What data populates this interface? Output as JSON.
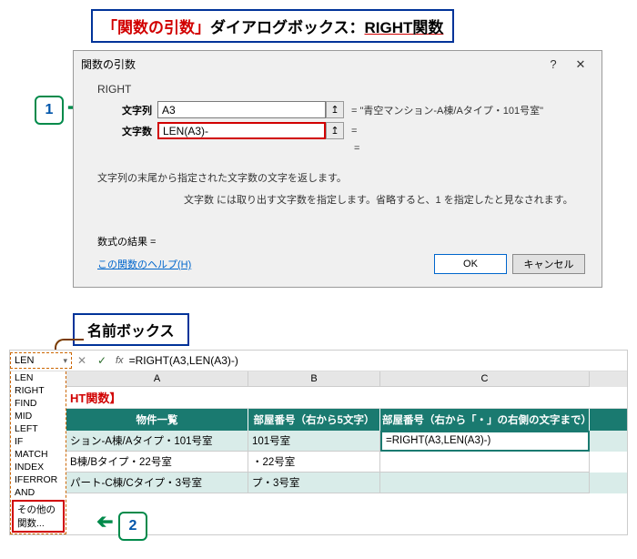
{
  "callout1": {
    "part1": "「関数の引数」",
    "part2": "ダイアログボックス：",
    "part3": "RIGHT関数"
  },
  "dialog": {
    "title": "関数の引数",
    "help_icon": "?",
    "close_icon": "✕",
    "func_name": "RIGHT",
    "arg1_label": "文字列",
    "arg1_value": "A3",
    "arg1_result": "=  \"青空マンション-A棟/Aタイプ・101号室\"",
    "arg2_label": "文字数",
    "arg2_value": "LEN(A3)-",
    "arg2_result": "=",
    "eq_only": "=",
    "desc_main": "文字列の末尾から指定された文字数の文字を返します。",
    "desc_sub": "文字数   には取り出す文字数を指定します。省略すると、1 を指定したと見なされます。",
    "formula_result": "数式の結果 =",
    "help_link": "この関数のヘルプ(H)",
    "ok": "OK",
    "cancel": "キャンセル"
  },
  "step1": "1",
  "callout2": "名前ボックス",
  "namebox_value": "LEN",
  "formula_bar": {
    "cross": "✕",
    "check": "✓",
    "fx": "fx",
    "value": "=RIGHT(A3,LEN(A3)-)"
  },
  "func_list": [
    "LEN",
    "RIGHT",
    "FIND",
    "MID",
    "LEFT",
    "IF",
    "MATCH",
    "INDEX",
    "IFERROR",
    "AND"
  ],
  "other_func": "その他の関数...",
  "columns": [
    "A",
    "B",
    "C"
  ],
  "cropped_title": "HT関数】",
  "headers": [
    "物件一覧",
    "部屋番号（右から5文字）",
    "部屋番号（右から「・」の右側の文字まで）"
  ],
  "rows": [
    {
      "a": "ション-A棟/Aタイプ・101号室",
      "b": "101号室",
      "c": "=RIGHT(A3,LEN(A3)-)"
    },
    {
      "a": "B棟/Bタイプ・22号室",
      "b": "・22号室",
      "c": ""
    },
    {
      "a": "パート-C棟/Cタイプ・3号室",
      "b": "プ・3号室",
      "c": ""
    }
  ],
  "step2": "2"
}
